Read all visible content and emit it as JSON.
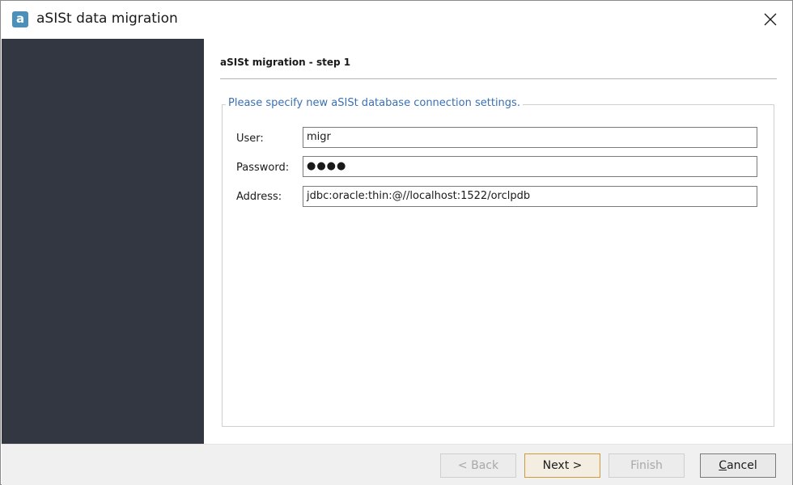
{
  "window": {
    "title": "aSISt data migration",
    "app_icon_letter": "a",
    "close_icon": "close-icon"
  },
  "wizard": {
    "step_title": "aSISt migration - step 1",
    "group_title": "Please specify new aSISt database connection settings.",
    "fields": {
      "user": {
        "label": "User:",
        "value": "migr"
      },
      "password": {
        "label": "Password:",
        "value": "●●●●"
      },
      "address": {
        "label": "Address:",
        "value": "jdbc:oracle:thin:@//localhost:1522/orclpdb"
      }
    }
  },
  "buttons": {
    "back": "< Back",
    "next": "Next >",
    "finish": "Finish",
    "cancel_prefix": "",
    "cancel_mnemonic": "C",
    "cancel_rest": "ancel"
  },
  "colors": {
    "sidebar": "#333742",
    "group_title": "#3a6fb5",
    "app_icon": "#4a90b8",
    "footer": "#f0f0f0"
  }
}
